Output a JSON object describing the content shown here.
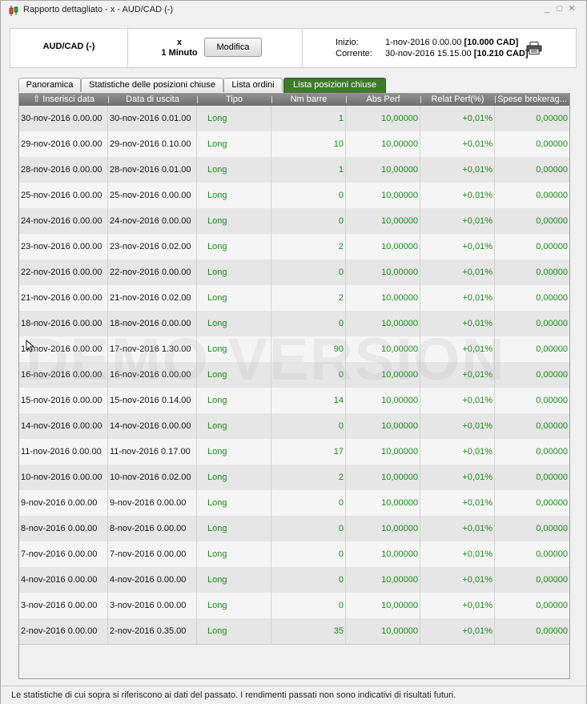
{
  "window": {
    "title": "Rapporto dettagliato - x - AUD/CAD (-)",
    "controls": [
      "_",
      "□",
      "✕"
    ]
  },
  "header": {
    "symbol": "AUD/CAD (-)",
    "timeframe_top": "x",
    "timeframe_bottom": "1 Minuto",
    "modify_label": "Modifica",
    "start_label": "Inizio:",
    "start_value": "1-nov-2016 0.00.00",
    "start_amount": "[10.000 CAD]",
    "current_label": "Corrente:",
    "current_value": "30-nov-2016 15.15.00",
    "current_amount": "[10.210 CAD]",
    "print_icon": "printer-icon"
  },
  "tabs": [
    {
      "label": "Panoramica",
      "active": false
    },
    {
      "label": "Statistiche delle posizioni chiuse",
      "active": false
    },
    {
      "label": "Lista ordini",
      "active": false
    },
    {
      "label": "Lista posizioni chiuse",
      "active": true
    }
  ],
  "columns": [
    "Inserisci data",
    "Data di uscita",
    "Tipo",
    "Nm barre",
    "Abs Perf",
    "Relat Perf(%)",
    "Spese brokerag..."
  ],
  "sort_icon": "sort-up-icon",
  "rows": [
    {
      "entry": "30-nov-2016 0.00.00",
      "exit": "30-nov-2016 0.01.00",
      "type": "Long",
      "bars": "1",
      "abs": "10,00000",
      "rel": "+0,01%",
      "fee": "0,00000"
    },
    {
      "entry": "29-nov-2016 0.00.00",
      "exit": "29-nov-2016 0.10.00",
      "type": "Long",
      "bars": "10",
      "abs": "10,00000",
      "rel": "+0,01%",
      "fee": "0,00000"
    },
    {
      "entry": "28-nov-2016 0.00.00",
      "exit": "28-nov-2016 0.01.00",
      "type": "Long",
      "bars": "1",
      "abs": "10,00000",
      "rel": "+0,01%",
      "fee": "0,00000"
    },
    {
      "entry": "25-nov-2016 0.00.00",
      "exit": "25-nov-2016 0.00.00",
      "type": "Long",
      "bars": "0",
      "abs": "10,00000",
      "rel": "+0,01%",
      "fee": "0,00000"
    },
    {
      "entry": "24-nov-2016 0.00.00",
      "exit": "24-nov-2016 0.00.00",
      "type": "Long",
      "bars": "0",
      "abs": "10,00000",
      "rel": "+0,01%",
      "fee": "0,00000"
    },
    {
      "entry": "23-nov-2016 0.00.00",
      "exit": "23-nov-2016 0.02.00",
      "type": "Long",
      "bars": "2",
      "abs": "10,00000",
      "rel": "+0,01%",
      "fee": "0,00000"
    },
    {
      "entry": "22-nov-2016 0.00.00",
      "exit": "22-nov-2016 0.00.00",
      "type": "Long",
      "bars": "0",
      "abs": "10,00000",
      "rel": "+0,01%",
      "fee": "0,00000"
    },
    {
      "entry": "21-nov-2016 0.00.00",
      "exit": "21-nov-2016 0.02.00",
      "type": "Long",
      "bars": "2",
      "abs": "10,00000",
      "rel": "+0,01%",
      "fee": "0,00000"
    },
    {
      "entry": "18-nov-2016 0.00.00",
      "exit": "18-nov-2016 0.00.00",
      "type": "Long",
      "bars": "0",
      "abs": "10,00000",
      "rel": "+0,01%",
      "fee": "0,00000"
    },
    {
      "entry": "17-nov-2016 0.00.00",
      "exit": "17-nov-2016 1.30.00",
      "type": "Long",
      "bars": "90",
      "abs": "10,00000",
      "rel": "+0,01%",
      "fee": "0,00000"
    },
    {
      "entry": "16-nov-2016 0.00.00",
      "exit": "16-nov-2016 0.00.00",
      "type": "Long",
      "bars": "0",
      "abs": "10,00000",
      "rel": "+0,01%",
      "fee": "0,00000"
    },
    {
      "entry": "15-nov-2016 0.00.00",
      "exit": "15-nov-2016 0.14.00",
      "type": "Long",
      "bars": "14",
      "abs": "10,00000",
      "rel": "+0,01%",
      "fee": "0,00000"
    },
    {
      "entry": "14-nov-2016 0.00.00",
      "exit": "14-nov-2016 0.00.00",
      "type": "Long",
      "bars": "0",
      "abs": "10,00000",
      "rel": "+0,01%",
      "fee": "0,00000"
    },
    {
      "entry": "11-nov-2016 0.00.00",
      "exit": "11-nov-2016 0.17.00",
      "type": "Long",
      "bars": "17",
      "abs": "10,00000",
      "rel": "+0,01%",
      "fee": "0,00000"
    },
    {
      "entry": "10-nov-2016 0.00.00",
      "exit": "10-nov-2016 0.02.00",
      "type": "Long",
      "bars": "2",
      "abs": "10,00000",
      "rel": "+0,01%",
      "fee": "0,00000"
    },
    {
      "entry": "9-nov-2016 0.00.00",
      "exit": "9-nov-2016 0.00.00",
      "type": "Long",
      "bars": "0",
      "abs": "10,00000",
      "rel": "+0,01%",
      "fee": "0,00000"
    },
    {
      "entry": "8-nov-2016 0.00.00",
      "exit": "8-nov-2016 0.00.00",
      "type": "Long",
      "bars": "0",
      "abs": "10,00000",
      "rel": "+0,01%",
      "fee": "0,00000"
    },
    {
      "entry": "7-nov-2016 0.00.00",
      "exit": "7-nov-2016 0.00.00",
      "type": "Long",
      "bars": "0",
      "abs": "10,00000",
      "rel": "+0,01%",
      "fee": "0,00000"
    },
    {
      "entry": "4-nov-2016 0.00.00",
      "exit": "4-nov-2016 0.00.00",
      "type": "Long",
      "bars": "0",
      "abs": "10,00000",
      "rel": "+0,01%",
      "fee": "0,00000"
    },
    {
      "entry": "3-nov-2016 0.00.00",
      "exit": "3-nov-2016 0.00.00",
      "type": "Long",
      "bars": "0",
      "abs": "10,00000",
      "rel": "+0,01%",
      "fee": "0,00000"
    },
    {
      "entry": "2-nov-2016 0.00.00",
      "exit": "2-nov-2016 0.35.00",
      "type": "Long",
      "bars": "35",
      "abs": "10,00000",
      "rel": "+0,01%",
      "fee": "0,00000"
    }
  ],
  "watermark": "DEMO VERSION",
  "footer": "Le statistiche di cui sopra si riferiscono ai dati del passato. I rendimenti passati non sono indicativi di risultati futuri.",
  "colors": {
    "accent": "#3e7a2c",
    "positive": "#1a8a1a",
    "header_bg": "#7f7f7f"
  }
}
